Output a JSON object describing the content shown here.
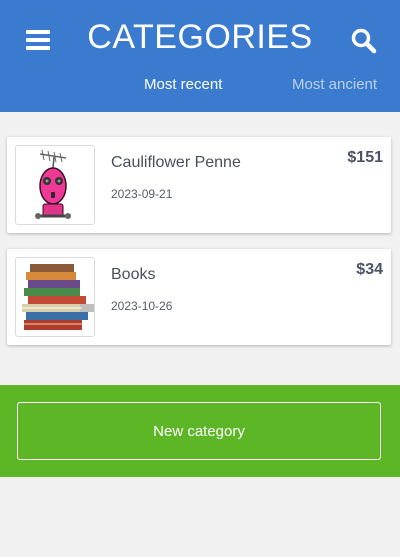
{
  "header": {
    "title": "CATEGORIES",
    "background": "#3a7bd0",
    "tabs": [
      {
        "label": "Most recent",
        "active": true
      },
      {
        "label": "Most ancient",
        "active": false
      }
    ]
  },
  "categories": [
    {
      "name": "Cauliflower Penne",
      "date": "2023-09-21",
      "price": "$151",
      "image": "pink-robot-icon"
    },
    {
      "name": "Books",
      "date": "2023-10-26",
      "price": "$34",
      "image": "book-stack-icon"
    }
  ],
  "footer": {
    "new_label": "New category",
    "background": "#5db626"
  }
}
